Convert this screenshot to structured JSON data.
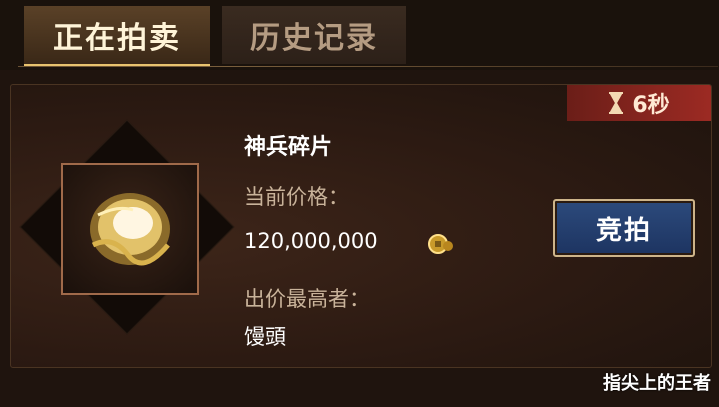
{
  "tabs": [
    {
      "label": "正在拍卖",
      "active": true
    },
    {
      "label": "历史记录",
      "active": false
    }
  ],
  "auction": {
    "timer": "6秒",
    "item_name": "神兵碎片",
    "price_label": "当前价格：",
    "price_value": "120,000,000",
    "bidder_label": "出价最高者：",
    "bidder_name": "馒頭",
    "bid_button": "竞拍"
  },
  "watermark": "指尖上的王者",
  "icons": {
    "timer": "hourglass-icon",
    "currency": "coin-icon",
    "item": "weapon-fragment-icon"
  },
  "colors": {
    "accent_gold": "#e8c36f",
    "timer_red": "#9c2a23",
    "button_blue": "#1d3461"
  }
}
